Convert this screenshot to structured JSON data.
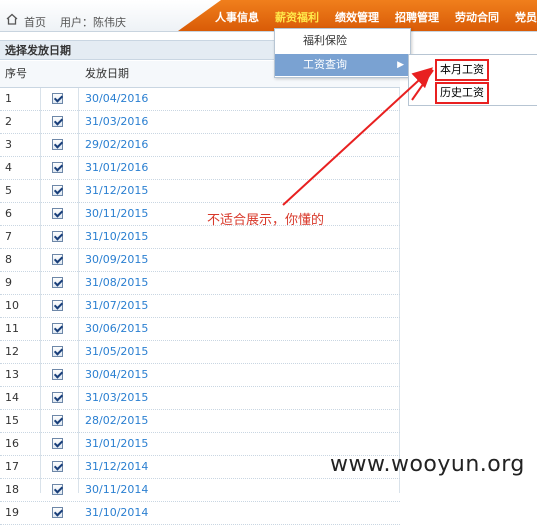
{
  "breadcrumb": {
    "home": "首页",
    "user": "用户：陈伟庆"
  },
  "nav": {
    "items": [
      "人事信息",
      "薪资福利",
      "绩效管理",
      "招聘管理",
      "劳动合同",
      "党员"
    ],
    "active_index": 1
  },
  "panel": {
    "title": "选择发放日期"
  },
  "table": {
    "headers": [
      "序号",
      "发放日期"
    ],
    "rows": [
      {
        "idx": "1",
        "date": "30/04/2016",
        "checked": true
      },
      {
        "idx": "2",
        "date": "31/03/2016",
        "checked": true
      },
      {
        "idx": "3",
        "date": "29/02/2016",
        "checked": true
      },
      {
        "idx": "4",
        "date": "31/01/2016",
        "checked": true
      },
      {
        "idx": "5",
        "date": "31/12/2015",
        "checked": true
      },
      {
        "idx": "6",
        "date": "30/11/2015",
        "checked": true
      },
      {
        "idx": "7",
        "date": "31/10/2015",
        "checked": true
      },
      {
        "idx": "8",
        "date": "30/09/2015",
        "checked": true
      },
      {
        "idx": "9",
        "date": "31/08/2015",
        "checked": true
      },
      {
        "idx": "10",
        "date": "31/07/2015",
        "checked": true
      },
      {
        "idx": "11",
        "date": "30/06/2015",
        "checked": true
      },
      {
        "idx": "12",
        "date": "31/05/2015",
        "checked": true
      },
      {
        "idx": "13",
        "date": "30/04/2015",
        "checked": true
      },
      {
        "idx": "14",
        "date": "31/03/2015",
        "checked": true
      },
      {
        "idx": "15",
        "date": "28/02/2015",
        "checked": true
      },
      {
        "idx": "16",
        "date": "31/01/2015",
        "checked": true
      },
      {
        "idx": "17",
        "date": "31/12/2014",
        "checked": true
      },
      {
        "idx": "18",
        "date": "30/11/2014",
        "checked": true
      },
      {
        "idx": "19",
        "date": "31/10/2014",
        "checked": true
      }
    ]
  },
  "dropdown": {
    "items": [
      "福利保险",
      "工资查询"
    ],
    "selected_index": 1
  },
  "submenu": {
    "items": [
      "本月工资",
      "历史工资"
    ]
  },
  "annotation": {
    "text": "不适合展示，你懂的"
  },
  "watermark": {
    "text": "www.wooyun.org"
  },
  "colors": {
    "nav_bg": "#e8700f",
    "nav_active": "#ffe94a",
    "date_link": "#2a7fd1",
    "highlight_box": "#e82020",
    "annotation": "#d8392b"
  }
}
